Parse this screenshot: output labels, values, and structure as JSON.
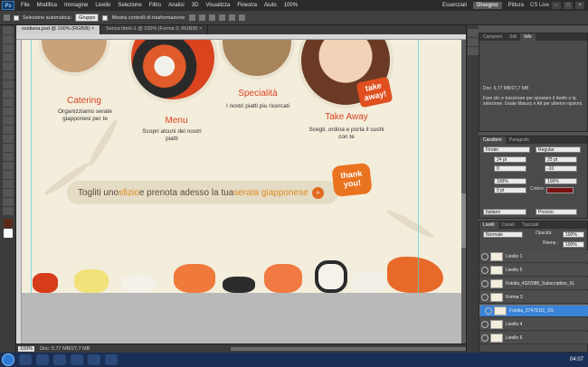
{
  "app": {
    "logo": "Ps"
  },
  "menubar": {
    "items": [
      "File",
      "Modifica",
      "Immagine",
      "Livello",
      "Selezione",
      "Filtro",
      "Analisi",
      "3D",
      "Visualizza",
      "Finestra",
      "Aiuto"
    ],
    "zoom": "100%",
    "workspaces": [
      "Essenziali",
      "Disegno",
      "Pittura"
    ],
    "active_workspace": "Disegno",
    "cs_live": "CS Live"
  },
  "options": {
    "auto_select_label": "Selezione automatica:",
    "auto_select_value": "Gruppo",
    "transform_label": "Mostra controlli di trasformazione"
  },
  "tabs": [
    {
      "label": "oxidiana.psd @ 100% (RGB/8) ×"
    },
    {
      "label": "Senza titolo-1 @ 100% (Forma 3, RGB/8) ×"
    }
  ],
  "canvas": {
    "sections": [
      {
        "title": "Catering",
        "text": "Organizziamo serate giapponesi per te"
      },
      {
        "title": "Menu",
        "text": "Scopri alcuni dei nostri piatti"
      },
      {
        "title": "Specialità",
        "text": "I nostri piatti piu ricercati"
      },
      {
        "title": "Take Away",
        "text": "Scegli, ordina e porta il sushi con te"
      }
    ],
    "takeaway_badge": "take away!",
    "banner": {
      "part1": "Togliti uno ",
      "hl1": "sfizio",
      "part2": " e prenota adesso la tua ",
      "hl2": "serata giapponese",
      "button": "»"
    },
    "thank_you": "thank you!"
  },
  "status": {
    "zoom": "100%",
    "doc": "Doc: 5,77 MB/27,7 MB"
  },
  "info_panel": {
    "tabs": [
      "Campioni",
      "Stili",
      "Info"
    ],
    "active": "Info",
    "doc": "Doc: 5,77 MB/27,7 MB",
    "hint": "Fare clic e trascinare per spostare il livello o la selezione. Usate Maiusc e Alt per ulteriori opzioni."
  },
  "char_panel": {
    "tabs": [
      "Carattere",
      "Paragrafo"
    ],
    "font": "Finder",
    "style": "Regular",
    "size": "24 pt",
    "leading": "25 pt",
    "kerning": "0",
    "tracking": "-10",
    "vscale": "100%",
    "hscale": "100%",
    "baseline": "0 pt",
    "color_label": "Colore:",
    "color": "#7a1010",
    "language": "Italiano",
    "antialias": "Preciso"
  },
  "layers_panel": {
    "tabs": [
      "Livelli",
      "Canali",
      "Tracciati"
    ],
    "mode": "Normale",
    "opacity_label": "Opacità:",
    "opacity": "100%",
    "fill_label": "Riemp.:",
    "fill": "100%",
    "layers": [
      {
        "name": "Livello 1",
        "selected": false
      },
      {
        "name": "Livello 5",
        "selected": false
      },
      {
        "name": "Fotolia_4322080_Subscription_XL",
        "selected": false
      },
      {
        "name": "Forma 3",
        "selected": false
      },
      {
        "name": "Fotolia_37479111_XS",
        "selected": true
      },
      {
        "name": "Livello 4",
        "selected": false
      },
      {
        "name": "Livello 6",
        "selected": false
      }
    ]
  },
  "taskbar": {
    "clock": "04:07"
  },
  "colors": {
    "accent": "#d9441f",
    "orange": "#e9731f",
    "layer_selected": "#3a83d8"
  }
}
